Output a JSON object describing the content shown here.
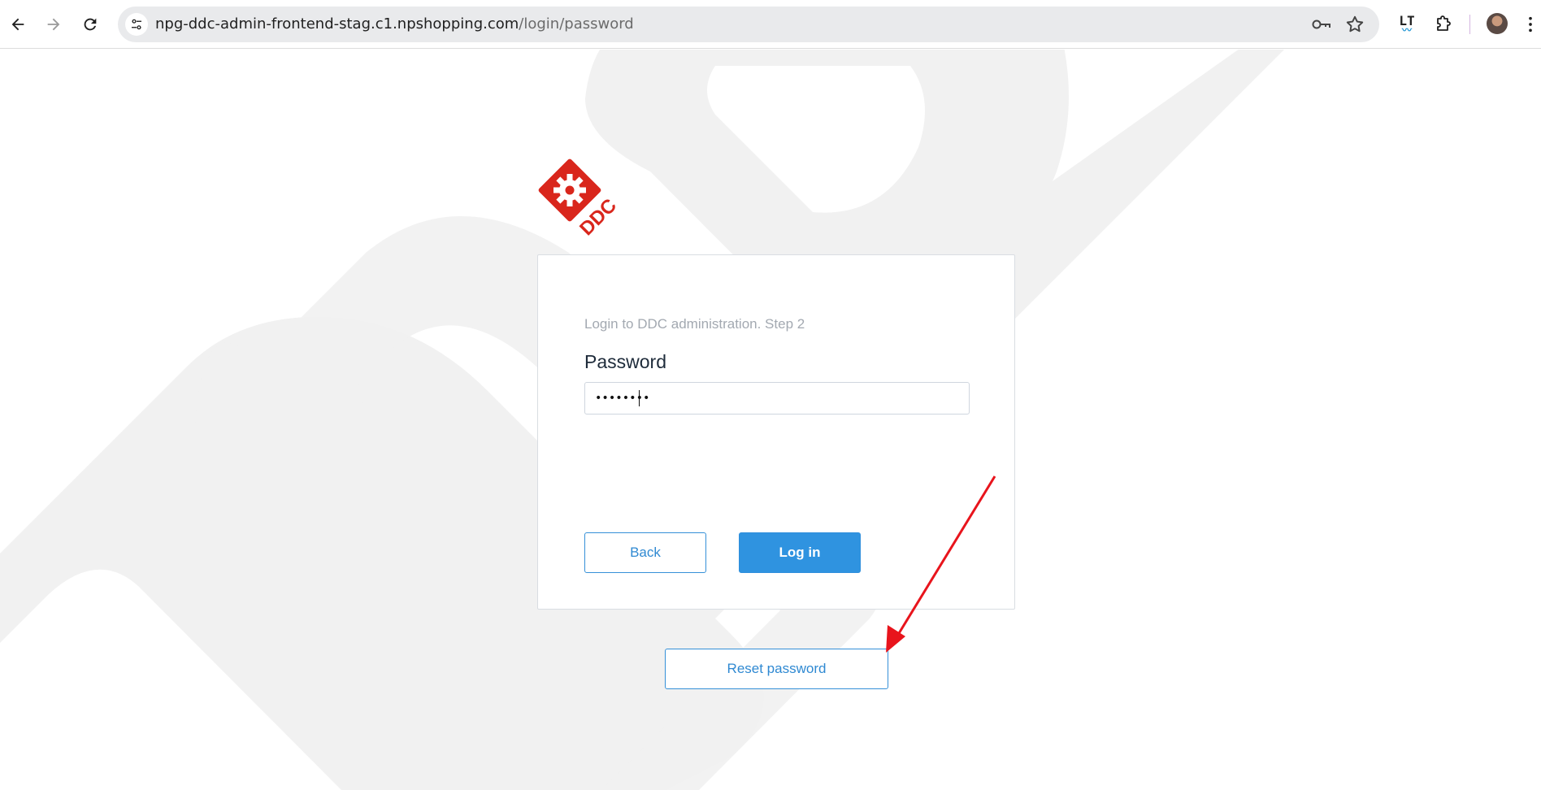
{
  "browser": {
    "url_host": "npg-ddc-admin-frontend-stag.c1.npshopping.com",
    "url_path": "/login/password",
    "icons": {
      "back": "arrow-left-icon",
      "forward": "arrow-right-icon",
      "reload": "reload-icon",
      "site_info": "tune-icon",
      "password_key": "key-icon",
      "bookmark": "star-icon",
      "extension_lt": "languagetool-icon",
      "extensions": "puzzle-icon",
      "profile": "avatar",
      "menu": "kebab-menu-icon"
    },
    "extension_lt_text": "LT"
  },
  "logo": {
    "text": "DDC",
    "color": "#d9261c"
  },
  "login": {
    "subtitle": "Login to DDC administration. Step 2",
    "password_label": "Password",
    "password_value": "••••••••",
    "back_label": "Back",
    "login_label": "Log in"
  },
  "reset": {
    "label": "Reset password"
  },
  "colors": {
    "accent": "#2f93e0",
    "annotation_arrow": "#e8141c",
    "watermark": "#f1f1f1"
  }
}
